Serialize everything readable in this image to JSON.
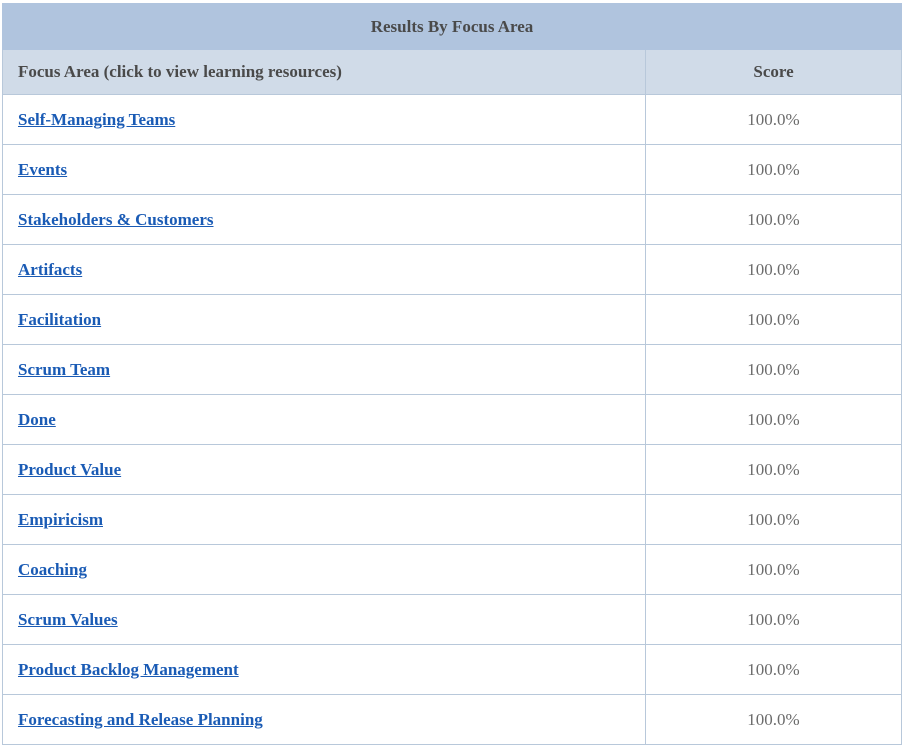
{
  "table": {
    "title": "Results By Focus Area",
    "headers": {
      "focus_area": "Focus Area (click to view learning resources)",
      "score": "Score"
    },
    "rows": [
      {
        "area": "Self-Managing Teams",
        "score": "100.0%"
      },
      {
        "area": "Events",
        "score": "100.0%"
      },
      {
        "area": "Stakeholders & Customers",
        "score": "100.0%"
      },
      {
        "area": "Artifacts",
        "score": "100.0%"
      },
      {
        "area": "Facilitation",
        "score": "100.0%"
      },
      {
        "area": "Scrum Team",
        "score": "100.0%"
      },
      {
        "area": "Done",
        "score": "100.0%"
      },
      {
        "area": "Product Value",
        "score": "100.0%"
      },
      {
        "area": "Empiricism",
        "score": "100.0%"
      },
      {
        "area": "Coaching",
        "score": "100.0%"
      },
      {
        "area": "Scrum Values",
        "score": "100.0%"
      },
      {
        "area": "Product Backlog Management",
        "score": "100.0%"
      },
      {
        "area": "Forecasting and Release Planning",
        "score": "100.0%"
      }
    ]
  },
  "colors": {
    "title_bg": "#b0c4de",
    "header_bg": "#d0dbe8",
    "link": "#1a5bb5",
    "border": "#b8c8da"
  }
}
